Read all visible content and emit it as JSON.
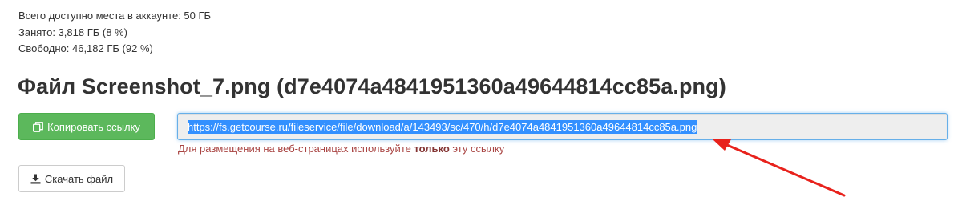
{
  "quota": {
    "total": "Всего доступно места в аккаунте: 50 ГБ",
    "used": "Занято: 3,818 ГБ (8 %)",
    "free": "Свободно: 46,182 ГБ (92 %)"
  },
  "file": {
    "title": "Файл Screenshot_7.png (d7e4074a4841951360a49644814cc85a.png)",
    "url": "https://fs.getcourse.ru/fileservice/file/download/a/143493/sc/470/h/d7e4074a4841951360a49644814cc85a.png"
  },
  "actions": {
    "copy_label": "Копировать ссылку",
    "download_label": "Скачать файл"
  },
  "hint": {
    "before": "Для размещения на веб-страницах используйте ",
    "emphasis": "только",
    "after": " эту ссылку"
  },
  "icons": {
    "copy": "copy-icon",
    "download": "download-icon"
  },
  "colors": {
    "copy_button": "#5cb85c",
    "hint_text": "#a94442",
    "selection": "#3390ff",
    "annotation_arrow": "#e8221c"
  }
}
